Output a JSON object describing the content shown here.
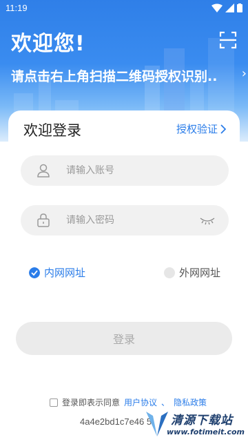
{
  "status_bar": {
    "time": "11:19"
  },
  "header": {
    "welcome": "欢迎您!",
    "scan_hint": "请点击右上角扫描二维码授权识别..",
    "scan_icon": "scan-icon"
  },
  "login_card": {
    "title": "欢迎登录",
    "auth_link": "授权验证",
    "account_placeholder": "请输入账号",
    "password_placeholder": "请输入密码",
    "radios": [
      {
        "label": "内网网址",
        "selected": true
      },
      {
        "label": "外网网址",
        "selected": false
      }
    ],
    "login_button": "登录"
  },
  "agreement": {
    "prefix": "登录即表示同意",
    "user_agreement": "用户协议",
    "separator": "、",
    "privacy_policy": "隐私政策"
  },
  "device_id": "4a4e2bd1c7e46 5",
  "watermark": {
    "title": "清源下载站",
    "url": "www.fotimeit.com"
  },
  "colors": {
    "accent": "#2b7de9",
    "header_top": "#2f7fe8",
    "field_bg": "#f1f1f1",
    "button_bg": "#ebebeb"
  }
}
